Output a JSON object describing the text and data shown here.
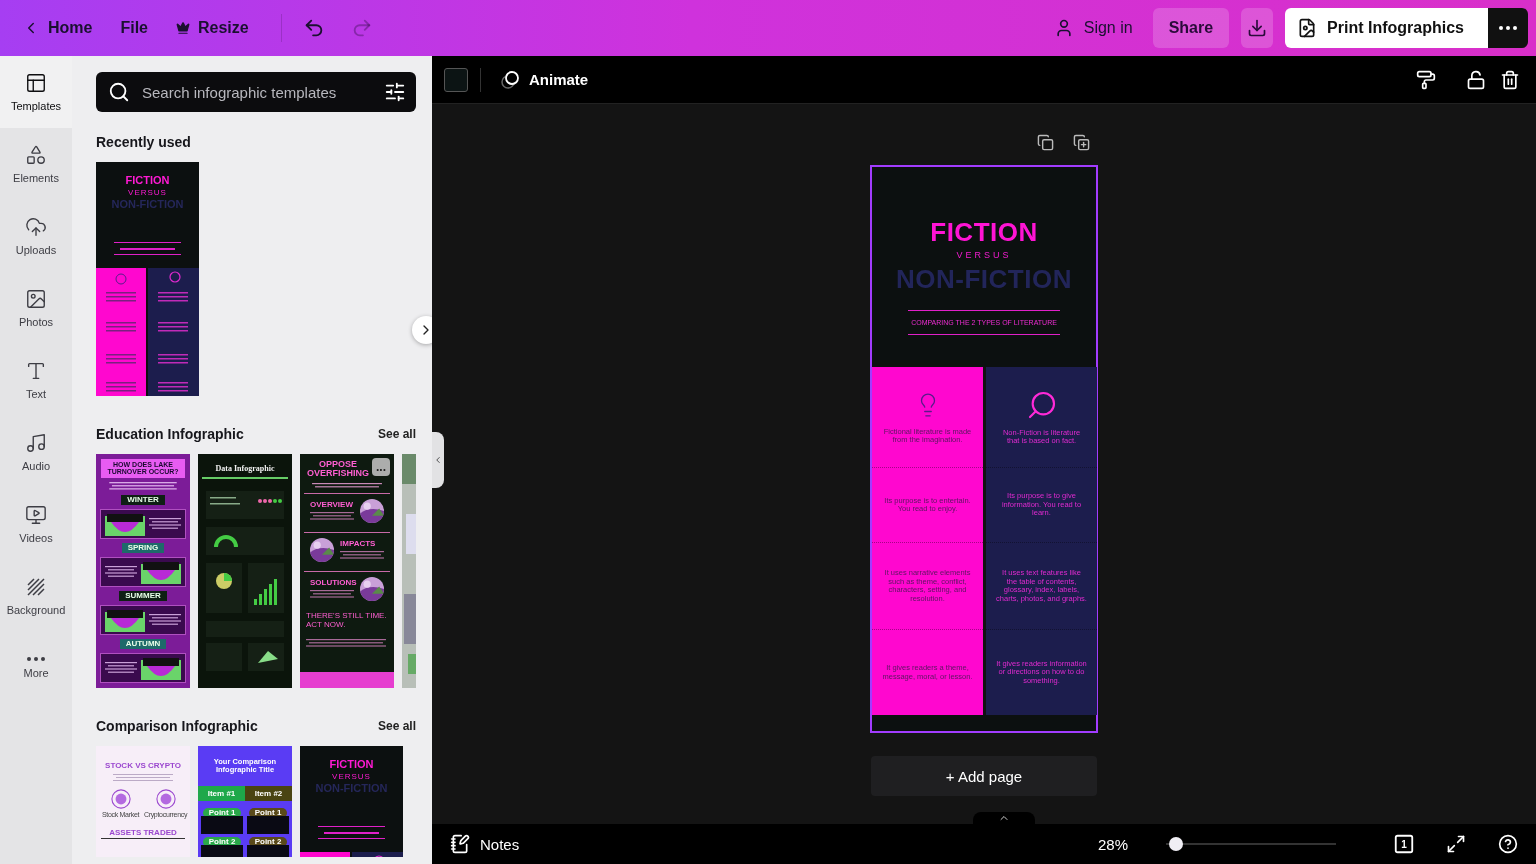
{
  "topbar": {
    "nav": [
      {
        "label": "Home",
        "kind": "back"
      },
      {
        "label": "File",
        "kind": "plain"
      },
      {
        "label": "Resize",
        "kind": "crown"
      }
    ],
    "undo": {
      "disabled": false
    },
    "redo": {
      "disabled": true
    },
    "sign_in": "Sign in",
    "share": "Share",
    "print": "Print Infographics"
  },
  "rail": [
    {
      "label": "Templates",
      "selected": true
    },
    {
      "label": "Elements",
      "selected": false
    },
    {
      "label": "Uploads",
      "selected": false
    },
    {
      "label": "Photos",
      "selected": false
    },
    {
      "label": "Text",
      "selected": false
    },
    {
      "label": "Audio",
      "selected": false
    },
    {
      "label": "Videos",
      "selected": false
    },
    {
      "label": "Background",
      "selected": false
    },
    {
      "label": "More",
      "selected": false
    }
  ],
  "panel": {
    "search": {
      "placeholder": "Search infographic templates"
    },
    "sections": [
      {
        "title": "Recently used",
        "templates": [
          {
            "kind": "fiction",
            "title": "FICTION",
            "versus": "VERSUS",
            "subtitle": "NON-FICTION"
          }
        ]
      },
      {
        "title": "Education Infographic",
        "see_all": "See all",
        "templates": [
          {
            "kind": "lake",
            "title": "HOW DOES LAKE TURNOVER OCCUR?",
            "sections": [
              "WINTER",
              "SPRING",
              "SUMMER",
              "AUTUMN"
            ]
          },
          {
            "kind": "data",
            "title": "Data Infographic"
          },
          {
            "kind": "overfishing",
            "title": "OPPOSE OVERFISHING",
            "sections": [
              "OVERVIEW",
              "IMPACTS",
              "SOLUTIONS"
            ],
            "callout": "THERE'S STILL TIME. ACT NOW.",
            "more": "..."
          },
          {
            "kind": "stub"
          }
        ]
      },
      {
        "title": "Comparison Infographic",
        "see_all": "See all",
        "templates": [
          {
            "kind": "stock",
            "title": "STOCK VS CRYPTO",
            "labels": [
              "Stock Market",
              "Cryptocurrency"
            ],
            "footer": "ASSETS TRADED"
          },
          {
            "kind": "comparison",
            "title": "Your Comparison Infographic Title",
            "items": [
              "Item #1",
              "Item #2"
            ],
            "points": [
              "Point 1",
              "Point 1",
              "Point 2",
              "Point 2"
            ]
          },
          {
            "kind": "fiction",
            "title": "FICTION",
            "versus": "VERSUS",
            "subtitle": "NON-FICTION"
          }
        ]
      }
    ]
  },
  "toolbar": {
    "animate": "Animate"
  },
  "design": {
    "title": "FICTION",
    "versus": "VERSUS",
    "subtitle": "NON-FICTION",
    "tagline": "COMPARING THE 2 TYPES OF LITERATURE",
    "rows": [
      [
        "Fictional literature is made from the imagination.",
        "Non-Fiction is literature that is based on fact."
      ],
      [
        "Its purpose is to entertain. You read to enjoy.",
        "Its purpose is to give information. You read to learn."
      ],
      [
        "It uses narrative elements such as theme, conflict, characters, setting, and resolution.",
        "It uses text features like the table of contents, glossary, index, labels, charts, photos, and graphs."
      ],
      [
        "It gives readers a theme, message, moral, or lesson.",
        "It gives readers information or directions on how to do something."
      ]
    ]
  },
  "add_page": "+ Add page",
  "footer": {
    "notes": "Notes",
    "zoom": "28%",
    "level": 0.02,
    "pages": "1"
  }
}
